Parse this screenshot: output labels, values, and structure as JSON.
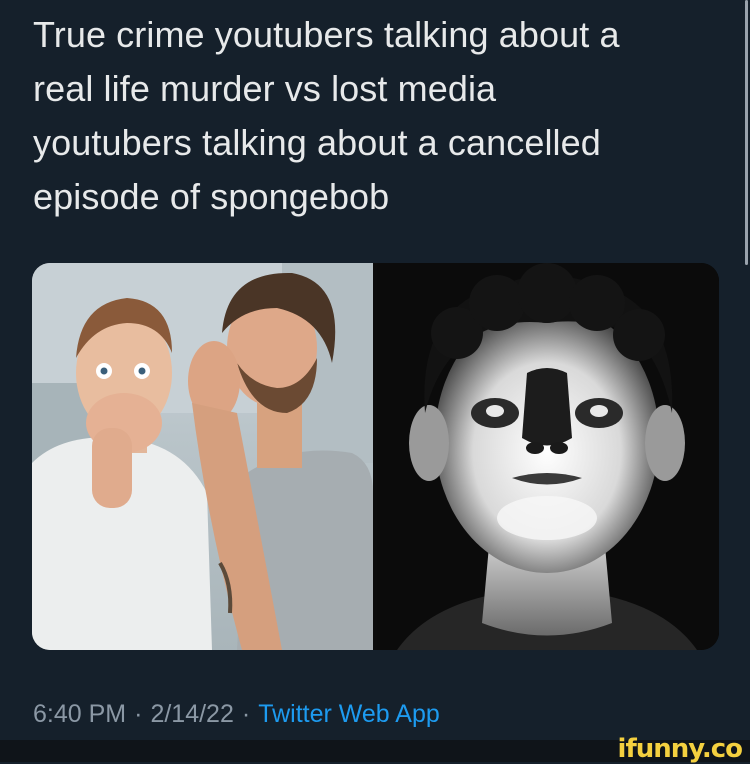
{
  "tweet": {
    "text_lines": [
      "True crime youtubers talking about a",
      "real life murder vs lost media",
      "youtubers talking about a cancelled",
      "episode of spongebob"
    ],
    "time": "6:40 PM",
    "date": "2/14/22",
    "separator": "·",
    "source": "Twitter Web App"
  },
  "watermark": "ifunny.co",
  "colors": {
    "background": "#15202b",
    "text": "#e7e9ea",
    "meta": "#8b98a5",
    "link": "#1d9bf0",
    "watermark": "#f4d03f"
  }
}
